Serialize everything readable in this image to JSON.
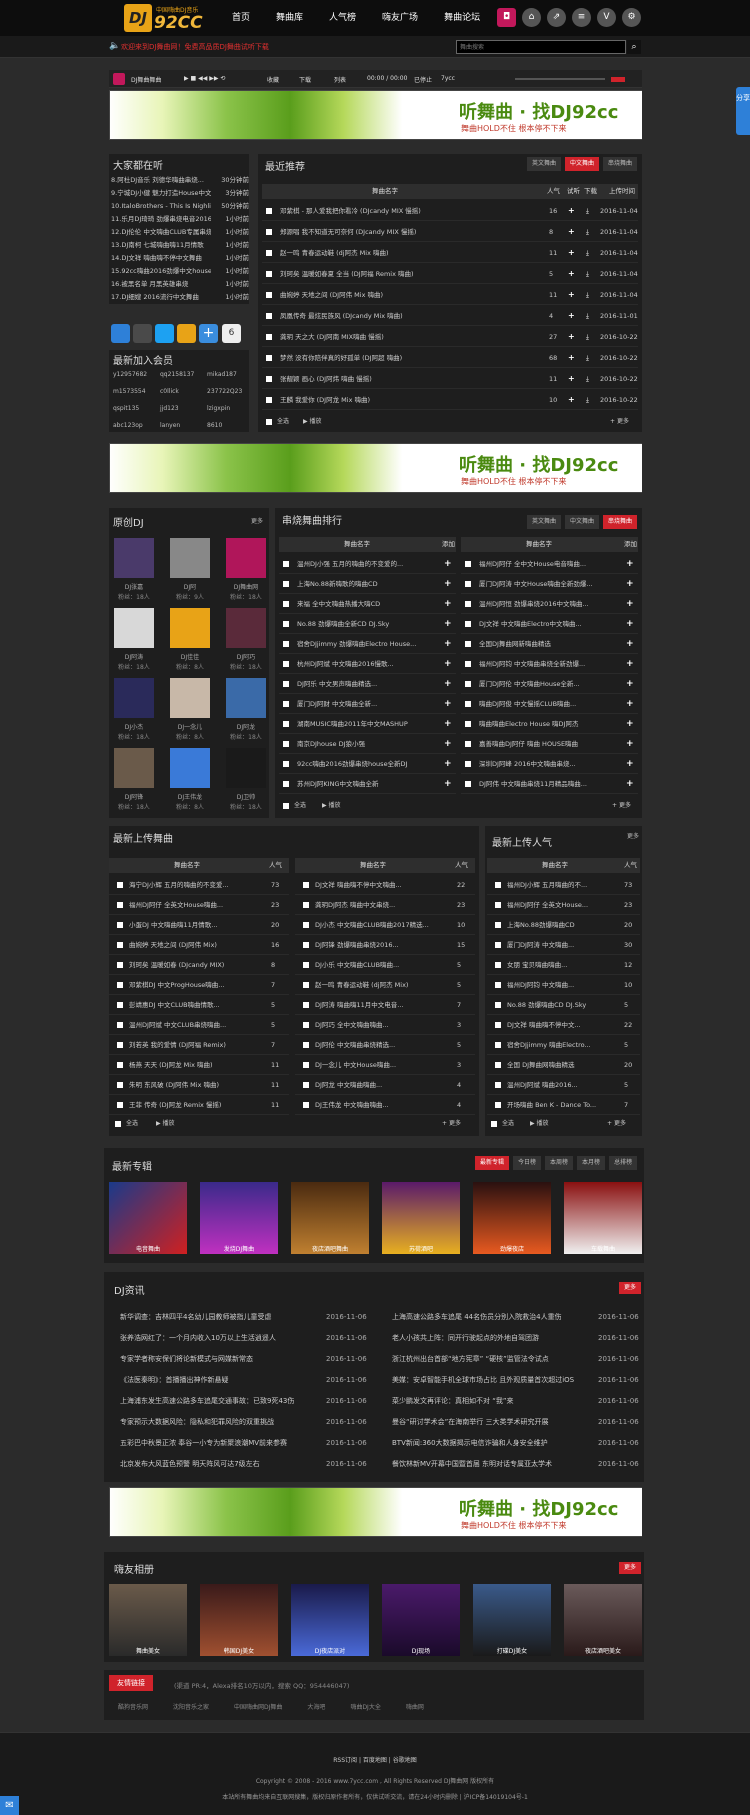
{
  "site": {
    "logo_mark": "DJ",
    "logo_text": "92CC",
    "logo_sub": "中国嗨曲DJ音乐"
  },
  "nav": [
    "首页",
    "舞曲库",
    "人气榜",
    "嗨友广场",
    "舞曲论坛"
  ],
  "topicons": [
    "dj",
    "home",
    "share",
    "list",
    "vip",
    "gear"
  ],
  "search": {
    "placeholder": "舞曲搜索"
  },
  "announce": "欢迎来到DJ舞曲网！免费高品质DJ舞曲试听下载",
  "share_tab": "分享",
  "player": {
    "title": "DJ舞曲舞曲",
    "fav": "收藏",
    "download": "下载",
    "list": "列表",
    "time": "00:00 / 00:00",
    "status": "已停止",
    "site": "7ycc"
  },
  "banner": {
    "title": "听舞曲 · 找DJ92cc",
    "sub": "舞曲HOLD不住 根本停不下来"
  },
  "hot": {
    "title": "大家都在听",
    "items": [
      "8.阿杜DJ音乐 刘德华嗨曲串烧...",
      "9.宁城DJ小健 魅力打造House中文",
      "10.ItaloBrothers - This Is Nighlife",
      "11.乐月DJ琦琦 劲爆串烧电音2016",
      "12.DJ伦伦 中文嗨曲CLUB专属串烧",
      "13.DJ南柯 七城嗨曲嗨11月情歌",
      "14.DJ文祥 嗨曲嗨不停中文舞曲",
      "15.92cc嗨曲2016劲爆中文house",
      "16.被黑名单 月黑英雄串烧",
      "17.DJ细嫂 2016流行中文舞曲"
    ],
    "times": [
      "30分钟前",
      "3分钟前",
      "50分钟前",
      "1小时前",
      "1小时前",
      "1小时前",
      "1小时前",
      "1小时前",
      "1小时前",
      "1小时前"
    ]
  },
  "members": {
    "title": "最新加入会员",
    "names": [
      "y12957682",
      "qq2158137",
      "mikad187",
      "m1573554",
      "c0llick",
      "237722Q23",
      "qspit135",
      "jjd123",
      "lzigxpin",
      "abc123op",
      "lanyen",
      "8610"
    ]
  },
  "recommend": {
    "title": "最近推荐",
    "tabs": [
      "英文舞曲",
      "中文舞曲",
      "串烧舞曲"
    ],
    "head": [
      "舞曲名字",
      "人气",
      "试听",
      "下载",
      "上传时间"
    ],
    "rows": [
      [
        "邓紫棋 - 那人爱我把你看冷 (DJcandy MIX 慢摇)",
        "16",
        "2016-11-04"
      ],
      [
        "郑源唱 我不知道无可奈何 (DJcandy MIX 慢摇)",
        "8",
        "2016-11-04"
      ],
      [
        "赵一鸣 青春运动鞋 (dj阿杰 Mix 嗨曲)",
        "11",
        "2016-11-04"
      ],
      [
        "刘珂矣 温暖如春夏 全当 (DJ阿福 Remix 嗨曲)",
        "5",
        "2016-11-04"
      ],
      [
        "曲婉婷 天地之间 (DJ阿伟 Mix 嗨曲)",
        "11",
        "2016-11-04"
      ],
      [
        "凤凰传奇 最炫民族风 (DJcandy Mix 嗨曲)",
        "4",
        "2016-11-01"
      ],
      [
        "龚玥 天之大 (DJ阿南 MIX嗨曲 慢摇)",
        "27",
        "2016-10-22"
      ],
      [
        "梦然 没有你陪伴真的好孤单 (DJ阿超 嗨曲)",
        "68",
        "2016-10-22"
      ],
      [
        "张靓颖 画心 (DJ阿炜 嗨曲 慢摇)",
        "11",
        "2016-10-22"
      ],
      [
        "王麟 我爱你 (DJ阿龙 Mix 嗨曲)",
        "10",
        "2016-10-22"
      ]
    ],
    "all": "全选",
    "play": "播放",
    "more": "更多"
  },
  "djs": {
    "title": "原创DJ",
    "more": "更多",
    "people": [
      {
        "name": "DJ张嘉",
        "fans": "粉丝：18人"
      },
      {
        "name": "DJ阿",
        "fans": "粉丝：9人"
      },
      {
        "name": "DJ舞曲网",
        "fans": "粉丝：18人"
      },
      {
        "name": "DJ阿涛",
        "fans": "粉丝：18人"
      },
      {
        "name": "DJ佳佳",
        "fans": "粉丝：8人"
      },
      {
        "name": "DJ阿巧",
        "fans": "粉丝：18人"
      },
      {
        "name": "DJ小杰",
        "fans": "粉丝：18人"
      },
      {
        "name": "DJ一念儿",
        "fans": "粉丝：8人"
      },
      {
        "name": "DJ阿龙",
        "fans": "粉丝：18人"
      },
      {
        "name": "DJ阿锋",
        "fans": "粉丝：18人"
      },
      {
        "name": "DJ王伟龙",
        "fans": "粉丝：8人"
      },
      {
        "name": "DJ卫帅",
        "fans": "粉丝：18人"
      }
    ]
  },
  "rank": {
    "title": "串烧舞曲排行",
    "tabs": [
      "英文舞曲",
      "中文舞曲",
      "串烧舞曲"
    ],
    "head": [
      "舞曲名字",
      "添加"
    ],
    "left": [
      "温州DJ小强 五月的嗨曲的不变爱的...",
      "上海No.88新嗨歌的嗨曲CD",
      "来福 全中文嗨曲热播大嗨CD",
      "No.88 劲爆嗨曲全新CD DJ.Sky",
      "宿舍DJjimmy 劲爆嗨曲Electro House...",
      "杭州DJ阿斌 中文嗨曲2016慢歌...",
      "DJ阿乐 中文男声嗨曲精选...",
      "厦门DJ阿财 中文嗨曲全新...",
      "湖南MUSIC嗨曲2011年中文MASHUP",
      "南京DJhouse DJ狼小强",
      "92cc嗨曲2016劲爆串烧house全新DJ",
      "苏州DJ阿KING中文嗨曲全新"
    ],
    "right": [
      "福州DJ阿仔 全中文House电音嗨曲...",
      "厦门DJ阿涛 中文House嗨曲全新劲爆...",
      "温州DJ阿恒 劲爆串烧2016中文嗨曲...",
      "DJ文祥 中文嗨曲Electro中文嗨曲...",
      "全国DJ舞曲网新嗨曲精选",
      "福州DJ阿钧 中文嗨曲串烧全新劲爆...",
      "厦门DJ阿伦 中文嗨曲House全新...",
      "嗨曲DJ阿俊 中文慢摇CLUB嗨曲...",
      "嗨曲嗨曲Electro House 嗨DJ阿杰",
      "嘉善嗨曲DJ阿仔 嗨曲 HOUSE嗨曲",
      "深圳DJ阿峰 2016中文嗨曲串烧...",
      "DJ阿伟 中文嗨曲串烧11月精品嗨曲..."
    ],
    "all": "全选",
    "play": "播放",
    "more": "更多"
  },
  "latest": {
    "title": "最新上传舞曲",
    "head": [
      "舞曲名字",
      "人气"
    ],
    "col1": [
      [
        "海宁DJ小辉 五月的嗨曲的不变爱...",
        "73"
      ],
      [
        "福州DJ阿仔 全英文House嗨曲...",
        "23"
      ],
      [
        "小蛋DJ 中文嗨曲嗨11月情歌...",
        "20"
      ],
      [
        "曲婉婷 天地之间 (DJ阿伟 Mix)",
        "16"
      ],
      [
        "刘珂矣 温暖如春 (DJcandy MIX)",
        "8"
      ],
      [
        "邓紫棋DJ 中文ProgHouse嗨曲...",
        "7"
      ],
      [
        "彭靖惠DJ 中文CLUB嗨曲情歌...",
        "5"
      ],
      [
        "温州DJ阿斌 中文CLUB串烧嗨曲...",
        "5"
      ],
      [
        "刘若英 我的爱情 (DJ阿福 Remix)",
        "7"
      ],
      [
        "杨燕 天天 (DJ阿龙 Mix 嗨曲)",
        "11"
      ],
      [
        "朱明 东风破 (DJ阿伟 Mix 嗨曲)",
        "11"
      ],
      [
        "王菲 传奇 (DJ阿龙 Remix 慢摇)",
        "11"
      ]
    ],
    "col2": [
      [
        "DJ文祥 嗨曲嗨不停中文嗨曲...",
        "22"
      ],
      [
        "龚玥DJ阿杰 嗨曲中文串烧...",
        "23"
      ],
      [
        "DJ小杰 中文嗨曲CLUB嗨曲2017精选...",
        "10"
      ],
      [
        "DJ阿锋 劲爆嗨曲串烧2016...",
        "15"
      ],
      [
        "DJ小乐 中文嗨曲CLUB嗨曲...",
        "5"
      ],
      [
        "赵一鸣 青春运动鞋 (dj阿杰 Mix)",
        "5"
      ],
      [
        "DJ阿涛 嗨曲嗨11月中文电音...",
        "7"
      ],
      [
        "DJ阿巧 全中文嗨曲嗨曲...",
        "3"
      ],
      [
        "DJ阿伦 中文嗨曲串烧精选...",
        "5"
      ],
      [
        "DJ一念儿 中文House嗨曲...",
        "3"
      ],
      [
        "DJ阿龙 中文嗨曲嗨曲...",
        "4"
      ],
      [
        "DJ王伟龙 中文嗨曲嗨曲...",
        "4"
      ]
    ],
    "all": "全选",
    "play": "播放",
    "more": "更多"
  },
  "popular": {
    "title": "最新上传人气",
    "more": "更多",
    "head": [
      "舞曲名字",
      "人气"
    ],
    "rows": [
      [
        "福州DJ小辉 五月嗨曲的不...",
        "73"
      ],
      [
        "福州DJ阿仔 全英文House...",
        "23"
      ],
      [
        "上海No.88劲爆嗨曲CD",
        "20"
      ],
      [
        "厦门DJ阿涛 中文嗨曲...",
        "30"
      ],
      [
        "女朋 宝贝嗨曲嗨曲...",
        "12"
      ],
      [
        "福州DJ阿钧 中文嗨曲...",
        "10"
      ],
      [
        "No.88 劲爆嗨曲CD DJ.Sky",
        "5"
      ],
      [
        "DJ文祥 嗨曲嗨不停中文...",
        "22"
      ],
      [
        "宿舍DJjimmy 嗨曲Electro...",
        "5"
      ],
      [
        "全国 DJ舞曲网嗨曲精选",
        "20"
      ],
      [
        "温州DJ阿斌 嗨曲2016...",
        "5"
      ],
      [
        "开场嗨曲 Ben K - Dance To...",
        "7"
      ]
    ],
    "all": "全选",
    "play": "播放",
    "more2": "更多"
  },
  "albums": {
    "title": "最新专辑",
    "tabs": [
      "最新专辑",
      "今日榜",
      "本周榜",
      "本月榜",
      "总排榜"
    ],
    "items": [
      "电音舞曲",
      "发烧DJ舞曲",
      "夜店酒吧舞曲",
      "苏荷酒吧",
      "劲爆夜店",
      "车载舞曲"
    ]
  },
  "news": {
    "title": "DJ资讯",
    "more": "更多",
    "left": [
      [
        "新华调查：吉林四平4名幼儿园教师被指儿童受虐",
        "2016-11-06"
      ],
      [
        "张养浩网红了：一个月内收入10万以上生活逍遥人",
        "2016-11-06"
      ],
      [
        "专家学者称安保们将论新模式与网媒新常态",
        "2016-11-06"
      ],
      [
        "《法医秦明》：首播播出神作新悬疑",
        "2016-11-06"
      ],
      [
        "上海浦东发生高速公路多车追尾交通事故：已致9死43伤",
        "2016-11-06"
      ],
      [
        "专家预示大数据风险：隐私和犯罪风险的双重挑战",
        "2016-11-06"
      ],
      [
        "五彩巴中秋景正浓 奉谷一小专为新聚浪潮MV前来参赛",
        "2016-11-06"
      ],
      [
        "北京发布大风蓝色预警 明天阵风可达7级左右",
        "2016-11-06"
      ]
    ],
    "right": [
      [
        "上海高速公路多车追尾 44名伤员分别入院救治4人重伤",
        "2016-11-06"
      ],
      [
        "老人小孩共上阵：同开行驶起点的外地自驾团游",
        "2016-11-06"
      ],
      [
        "浙江杭州出台首部“地方宪章” “硬核”监管法令试点",
        "2016-11-06"
      ],
      [
        "美媒：安卓智能手机全球市场占比 且外观质量首次超过iOS",
        "2016-11-06"
      ],
      [
        "菜少鹏发文再评论：真相如不对 “我”来",
        "2016-11-06"
      ],
      [
        "曼谷“研讨学术会”在海南举行 三大类学术研究开展",
        "2016-11-06"
      ],
      [
        "BTV新闻:360大数据揭示电信诈骗和人身安全维护",
        "2016-11-06"
      ],
      [
        "餐饮林新MV开幕中国暨首届 东明对话专属亚太学术",
        "2016-11-06"
      ]
    ]
  },
  "photos": {
    "title": "嗨友相册",
    "more": "更多",
    "items": [
      "舞曲美女",
      "韩国DJ美女",
      "DJ夜店派对",
      "DJ现场",
      "打碟DJ美女",
      "夜店酒吧美女"
    ]
  },
  "links": {
    "label": "友情链接",
    "stats": "(渠道 PR:4，Alexa排名10万以内，搜索 QQ：954446047)",
    "items": [
      "酷狗音乐网",
      "沈阳音乐之家",
      "中国嗨曲网DJ舞曲",
      "大海吧",
      "嗨曲DJ大全",
      "嗨曲网"
    ]
  },
  "footer": {
    "links": "RSS订阅 | 百度地图 | 谷歌地图",
    "copy": "Copyright © 2008 - 2016 www.7ycc.com , All Rights Reserved  DJ舞曲网 版权所有",
    "icp": "本站所有舞曲均来自互联网搜集，版权归原作者所有，仅供试听交流，请在24小时内删除 | 沪ICP备14019104号-1"
  },
  "colors": {
    "accent": "#d0232b",
    "brand": "#e8a317",
    "background": "#2b2b2b",
    "share": "#2e80d8"
  }
}
